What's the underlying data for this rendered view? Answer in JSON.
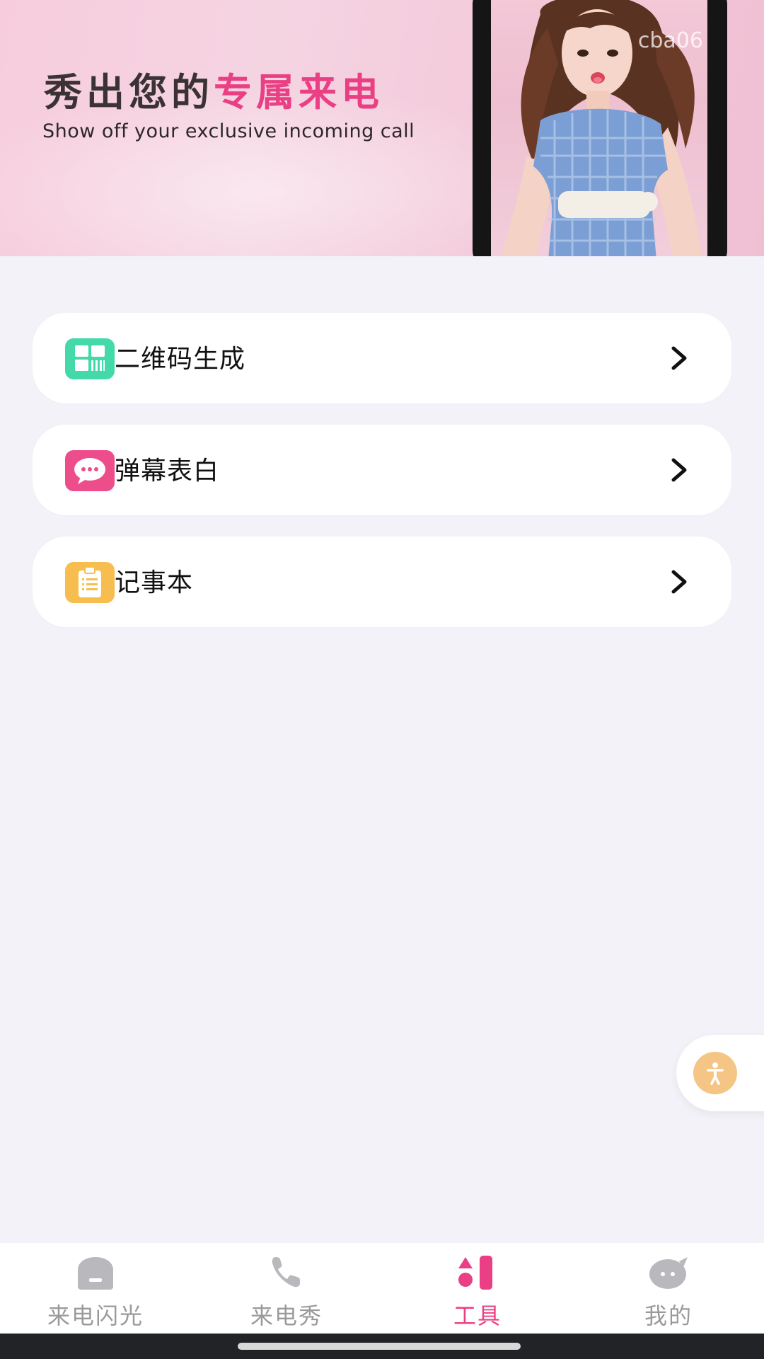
{
  "banner": {
    "title_main": "秀出您的",
    "title_accent": "专属来电",
    "subtitle": "Show off your exclusive incoming call",
    "watermark": "cba06"
  },
  "menu": {
    "items": [
      {
        "label": "二维码生成",
        "icon": "qr-code-icon",
        "color": "#44d9a9"
      },
      {
        "label": "弹幕表白",
        "icon": "chat-bubble-icon",
        "color": "#ee4d8c"
      },
      {
        "label": "记事本",
        "icon": "notepad-icon",
        "color": "#f7bd4e"
      }
    ]
  },
  "floating_button": {
    "icon": "accessibility-icon",
    "color": "#f5c585"
  },
  "bottom_nav": {
    "items": [
      {
        "label": "来电闪光",
        "icon": "flash-lamp-icon",
        "active": false
      },
      {
        "label": "来电秀",
        "icon": "phone-icon",
        "active": false
      },
      {
        "label": "工具",
        "icon": "tools-icon",
        "active": true
      },
      {
        "label": "我的",
        "icon": "profile-chat-icon",
        "active": false
      }
    ],
    "active_color": "#ea3f84",
    "inactive_color": "#9a9a9a"
  }
}
